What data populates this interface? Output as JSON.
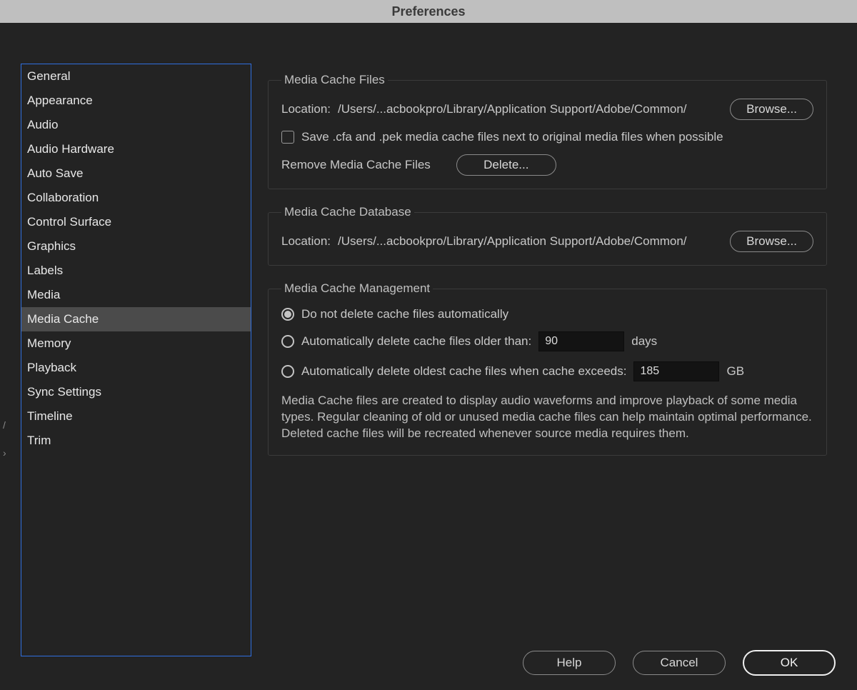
{
  "title": "Preferences",
  "sidebar": {
    "items": [
      {
        "label": "General"
      },
      {
        "label": "Appearance"
      },
      {
        "label": "Audio"
      },
      {
        "label": "Audio Hardware"
      },
      {
        "label": "Auto Save"
      },
      {
        "label": "Collaboration"
      },
      {
        "label": "Control Surface"
      },
      {
        "label": "Graphics"
      },
      {
        "label": "Labels"
      },
      {
        "label": "Media"
      },
      {
        "label": "Media Cache"
      },
      {
        "label": "Memory"
      },
      {
        "label": "Playback"
      },
      {
        "label": "Sync Settings"
      },
      {
        "label": "Timeline"
      },
      {
        "label": "Trim"
      }
    ],
    "selected_index": 10
  },
  "groups": {
    "files": {
      "legend": "Media Cache Files",
      "location_label": "Location:",
      "location_value": "/Users/...acbookpro/Library/Application Support/Adobe/Common/",
      "browse_label": "Browse...",
      "save_next_to_label": "Save .cfa and .pek media cache files next to original media files when possible",
      "save_next_to_checked": false,
      "remove_label": "Remove Media Cache Files",
      "delete_label": "Delete..."
    },
    "database": {
      "legend": "Media Cache Database",
      "location_label": "Location:",
      "location_value": "/Users/...acbookpro/Library/Application Support/Adobe/Common/",
      "browse_label": "Browse..."
    },
    "management": {
      "legend": "Media Cache Management",
      "option1_label": "Do not delete cache files automatically",
      "option2_label": "Automatically delete cache files older than:",
      "option2_value": "90",
      "option2_unit": "days",
      "option3_label": "Automatically delete oldest cache files when cache exceeds:",
      "option3_value": "185",
      "option3_unit": "GB",
      "selected_option": 0,
      "description": "Media Cache files are created to display audio waveforms and improve playback of some media types.  Regular cleaning of old or unused media cache files can help maintain optimal performance. Deleted cache files will be recreated whenever source media requires them."
    }
  },
  "footer": {
    "help_label": "Help",
    "cancel_label": "Cancel",
    "ok_label": "OK"
  }
}
